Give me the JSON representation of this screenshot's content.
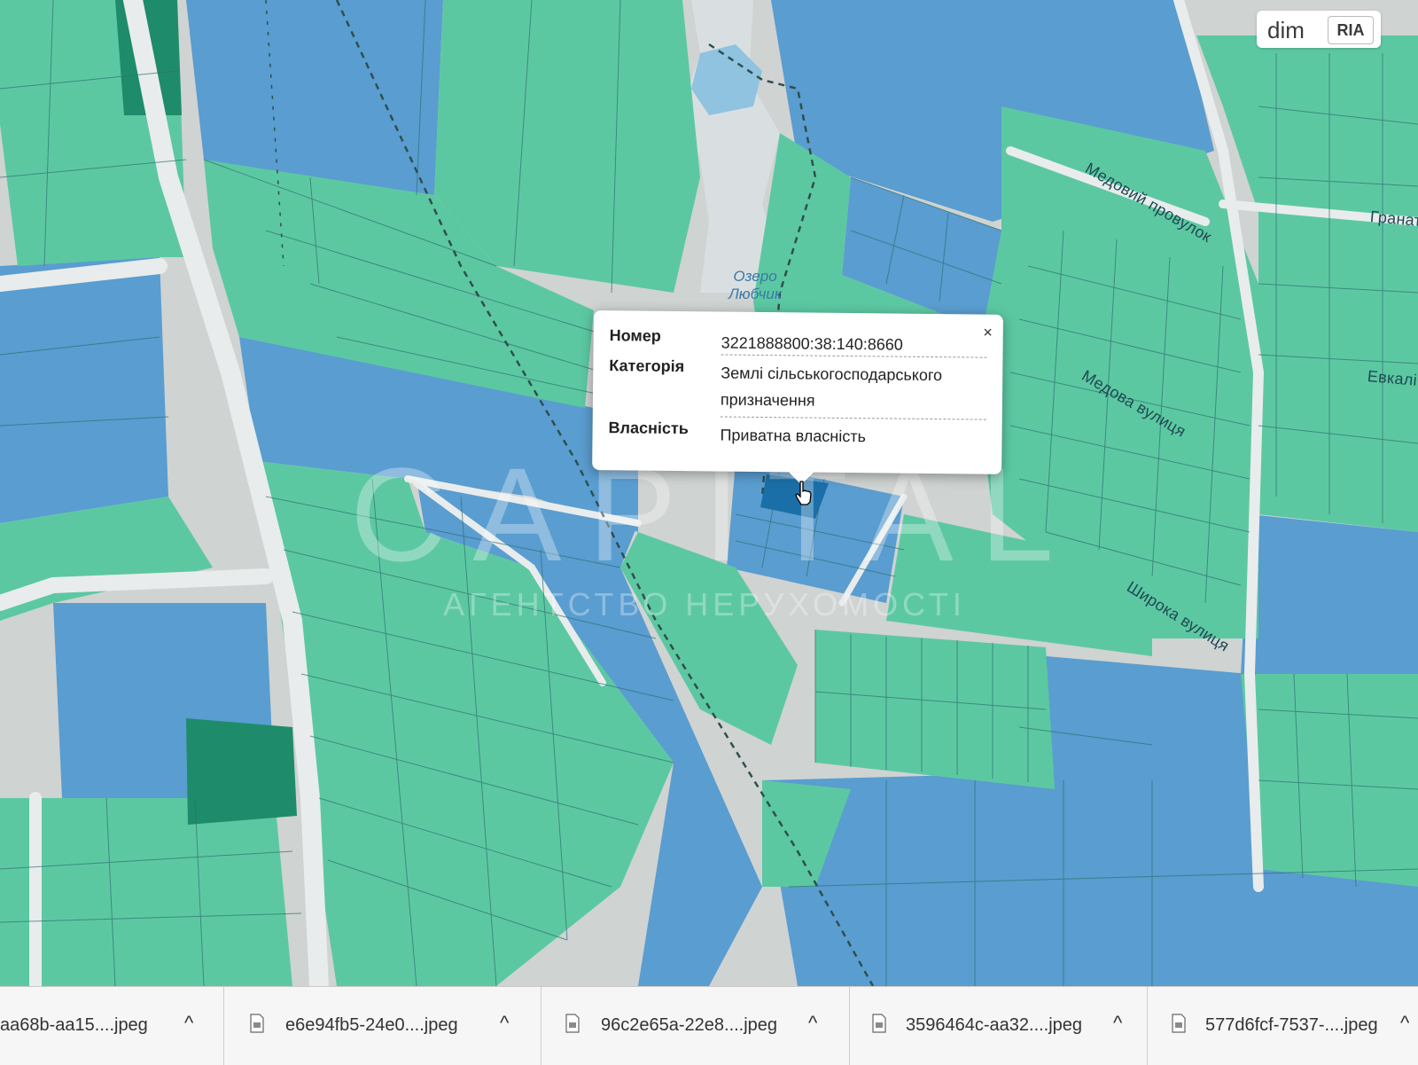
{
  "popup": {
    "rows": [
      {
        "label": "Номер",
        "value": "3221888800:38:140:8660"
      },
      {
        "label": "Категорія",
        "value": "Землі сільськогосподарського призначення"
      },
      {
        "label": "Власність",
        "value": "Приватна власність"
      }
    ],
    "close_symbol": "×"
  },
  "map": {
    "lake_label": "Озеро Любчик",
    "street_labels": [
      "Медовий провулок",
      "Медова вулиця",
      "Широка вулиця",
      "Гранат",
      "Евкалі"
    ],
    "colors": {
      "parcel_green": "#5cc8a2",
      "parcel_blue": "#5a9dd0",
      "parcel_dark_green": "#1e8c6a",
      "selected_parcel": "#1b6fa8",
      "road": "#e8ecec",
      "background": "#cfd3d2"
    }
  },
  "watermark": {
    "title": "CAPITAL",
    "subtitle": "АГЕНТСТВО НЕРУХОМОСТІ"
  },
  "logo": {
    "dim": "dim",
    "ria": "RIA"
  },
  "downloads": [
    {
      "name": "aa68b-aa15....jpeg",
      "icon": "jpeg-file-icon",
      "chevron": "^"
    },
    {
      "name": "e6e94fb5-24e0....jpeg",
      "icon": "jpeg-file-icon",
      "chevron": "^"
    },
    {
      "name": "96c2e65a-22e8....jpeg",
      "icon": "jpeg-file-icon",
      "chevron": "^"
    },
    {
      "name": "3596464c-aa32....jpeg",
      "icon": "jpeg-file-icon",
      "chevron": "^"
    },
    {
      "name": "577d6fcf-7537-....jpeg",
      "icon": "jpeg-file-icon",
      "chevron": "^"
    }
  ]
}
